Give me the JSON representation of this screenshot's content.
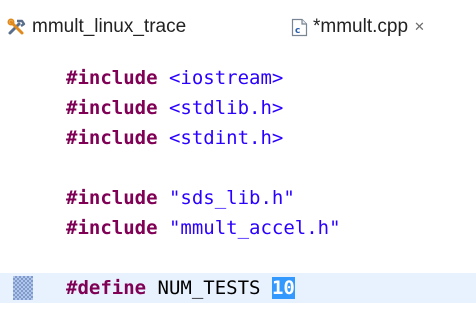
{
  "tabs": [
    {
      "label": "mmult_linux_trace",
      "icon": "trace-tools-icon",
      "active": false
    },
    {
      "label": "*mmult.cpp",
      "icon": "cpp-file-icon",
      "active": true,
      "close": "✕"
    }
  ],
  "editor": {
    "lines": [
      {
        "keyword": "#include",
        "arg": "<iostream>"
      },
      {
        "keyword": "#include",
        "arg": "<stdlib.h>"
      },
      {
        "keyword": "#include",
        "arg": "<stdint.h>"
      },
      {
        "keyword": "",
        "arg": ""
      },
      {
        "keyword": "#include",
        "arg": "\"sds_lib.h\""
      },
      {
        "keyword": "#include",
        "arg": "\"mmult_accel.h\""
      },
      {
        "keyword": "",
        "arg": ""
      },
      {
        "keyword": "#define",
        "name": "NUM_TESTS",
        "value": "10",
        "current": true
      }
    ]
  },
  "colors": {
    "keyword": "#7f0055",
    "string": "#2a00ff",
    "selection": "#3399ff",
    "current_line": "#e8f2fe"
  }
}
